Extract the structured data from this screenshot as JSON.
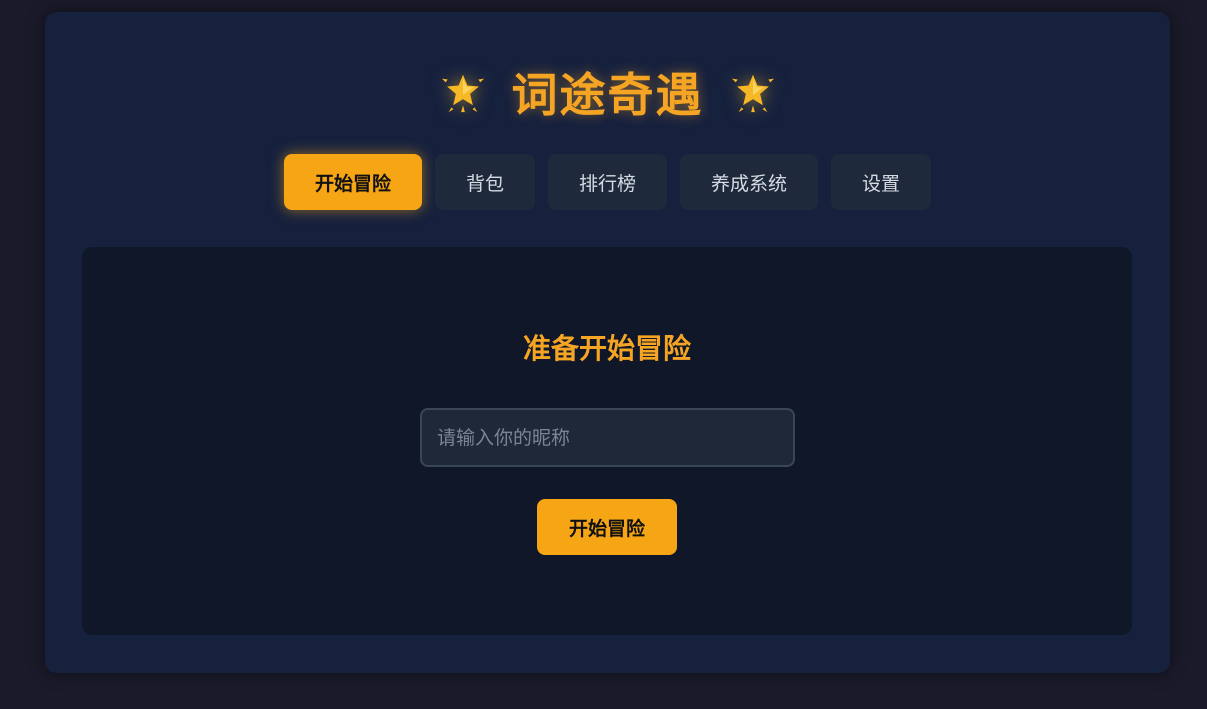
{
  "app": {
    "title": "词途奇遇",
    "title_icon": "glowing-star-icon",
    "accent_color": "#f6a514"
  },
  "nav": {
    "tabs": [
      {
        "label": "开始冒险",
        "active": true
      },
      {
        "label": "背包",
        "active": false
      },
      {
        "label": "排行榜",
        "active": false
      },
      {
        "label": "养成系统",
        "active": false
      },
      {
        "label": "设置",
        "active": false
      }
    ]
  },
  "start_panel": {
    "heading": "准备开始冒险",
    "nickname_placeholder": "请输入你的昵称",
    "nickname_value": "",
    "start_button_label": "开始冒险"
  }
}
